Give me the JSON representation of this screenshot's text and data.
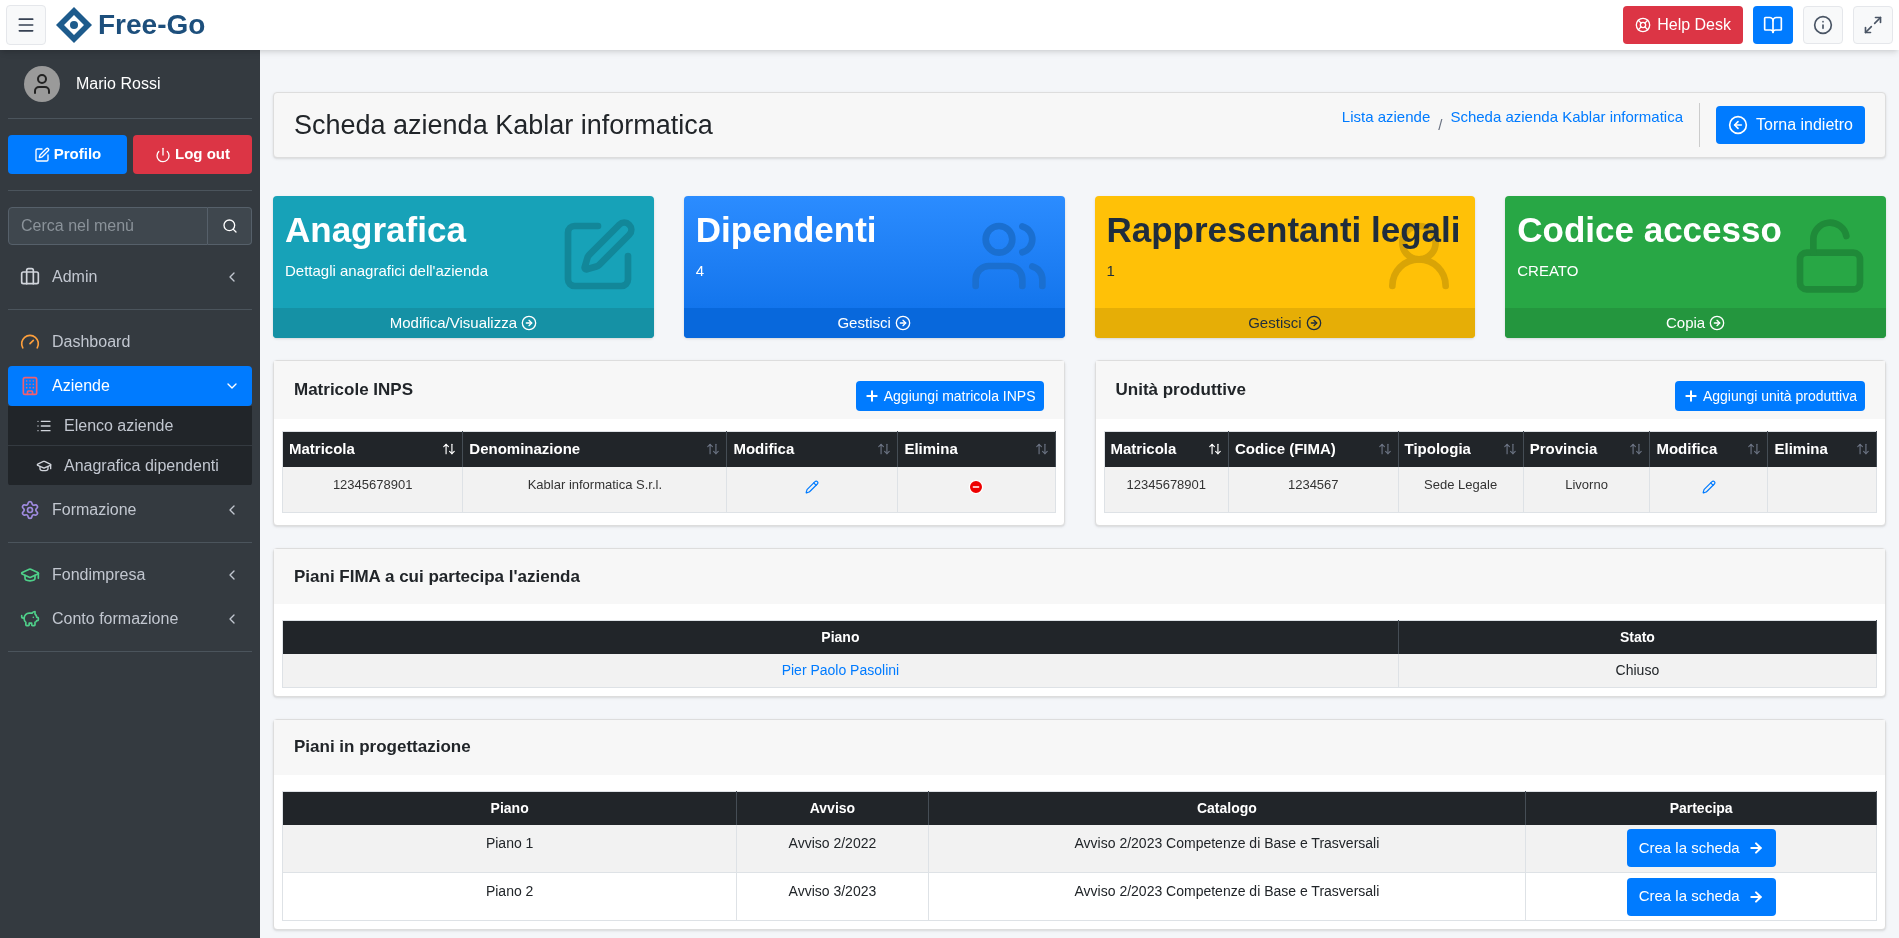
{
  "header": {
    "logo_text": "Free-Go",
    "help_desk": "Help Desk"
  },
  "sidebar": {
    "user": "Mario Rossi",
    "profile_button": "Profilo",
    "logout_button": "Log out",
    "search": {
      "placeholder": "Cerca nel menù"
    },
    "groups": [
      [
        {
          "label": "Admin",
          "selected": false,
          "expanded": false
        }
      ],
      [
        {
          "label": "Dashboard",
          "selected": false
        },
        {
          "label": "Aziende",
          "selected": true,
          "expanded": true,
          "children": [
            {
              "label": "Elenco aziende"
            },
            {
              "label": "Anagrafica dipendenti"
            }
          ]
        },
        {
          "label": "Formazione",
          "selected": false,
          "expanded": false
        }
      ],
      [
        {
          "label": "Fondimpresa",
          "selected": false,
          "expanded": false
        },
        {
          "label": "Conto formazione",
          "selected": false,
          "expanded": false
        }
      ]
    ]
  },
  "page_title": "Scheda azienda Kablar informatica",
  "breadcrumb": [
    "Lista aziende",
    "Scheda azienda Kablar informatica"
  ],
  "breadcrumb_separator": "/",
  "back_button": "Torna indietro",
  "cards": [
    {
      "kind": "info",
      "title": "Anagrafica",
      "text": "Dettagli anagrafici dell'azienda",
      "footer": "Modifica/Visualizza"
    },
    {
      "kind": "primary",
      "title": "Dipendenti",
      "text": "4",
      "footer": "Gestisci"
    },
    {
      "kind": "warning",
      "title": "Rappresentanti legali",
      "text": "1",
      "footer": "Gestisci"
    },
    {
      "kind": "success",
      "title": "Codice accesso",
      "text": "CREATO",
      "footer": "Copia"
    }
  ],
  "matricole": {
    "title": "Matricole INPS",
    "add_button": "Aggiungi matricola INPS",
    "columns": [
      {
        "label": "Matricola",
        "sorted": true
      },
      {
        "label": "Denominazione",
        "sorted": false
      },
      {
        "label": "Modifica",
        "sorted": false
      },
      {
        "label": "Elimina",
        "sorted": false
      }
    ],
    "rows": [
      {
        "matricola": "12345678901",
        "denominazione": "Kablar informatica S.r.l.",
        "editable": true,
        "deletable": true
      }
    ]
  },
  "unita": {
    "title": "Unità produttive",
    "add_button": "Aggiungi unità produttiva",
    "columns": [
      {
        "label": "Matricola",
        "sorted": true
      },
      {
        "label": "Codice (FIMA)",
        "sorted": false
      },
      {
        "label": "Tipologia",
        "sorted": false
      },
      {
        "label": "Provincia",
        "sorted": false
      },
      {
        "label": "Modifica",
        "sorted": false
      },
      {
        "label": "Elimina",
        "sorted": false
      }
    ],
    "rows": [
      {
        "matricola": "12345678901",
        "codice": "1234567",
        "tipologia": "Sede Legale",
        "provincia": "Livorno",
        "editable": true,
        "deletable": false
      }
    ]
  },
  "piani_fima": {
    "title": "Piani FIMA a cui partecipa l'azienda",
    "columns": [
      "Piano",
      "Stato"
    ],
    "rows": [
      {
        "piano": "Pier Paolo Pasolini",
        "stato": "Chiuso"
      }
    ]
  },
  "piani_progettazione": {
    "title": "Piani in progettazione",
    "columns": [
      "Piano",
      "Avviso",
      "Catalogo",
      "Partecipa"
    ],
    "rows": [
      {
        "piano": "Piano 1",
        "avviso": "Avviso 2/2022",
        "catalogo": "Avviso 2/2023 Competenze di Base e Trasversali",
        "action": "Crea la scheda"
      },
      {
        "piano": "Piano 2",
        "avviso": "Avviso 3/2023",
        "catalogo": "Avviso 2/2023 Competenze di Base e Trasversali",
        "action": "Crea la scheda"
      }
    ]
  }
}
